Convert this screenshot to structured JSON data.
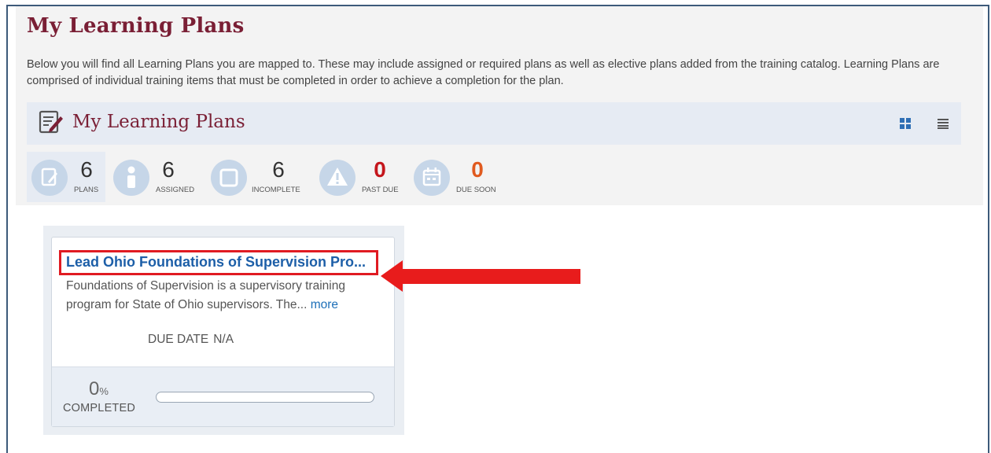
{
  "page": {
    "title": "My Learning Plans",
    "intro": "Below you will find all Learning Plans you are mapped to. These may include assigned or required plans as well as elective plans added from the training catalog. Learning Plans are comprised of individual training items that must be completed in order to achieve a completion for the plan."
  },
  "header": {
    "title": "My Learning Plans",
    "icon": "edit-document-icon",
    "grid_view_icon": "grid-view-icon",
    "list_view_icon": "list-view-icon"
  },
  "stats": [
    {
      "count": "6",
      "label": "PLANS",
      "icon": "plans-icon"
    },
    {
      "count": "6",
      "label": "ASSIGNED",
      "icon": "info-person-icon"
    },
    {
      "count": "6",
      "label": "INCOMPLETE",
      "icon": "incomplete-square-icon"
    },
    {
      "count": "0",
      "label": "PAST DUE",
      "icon": "warning-icon"
    },
    {
      "count": "0",
      "label": "DUE SOON",
      "icon": "calendar-icon"
    }
  ],
  "plan_card": {
    "title": "Lead Ohio Foundations of Supervision Pro...",
    "description": "Foundations of Supervision is a supervisory training program for State of Ohio supervisors. The...",
    "more_label": "more",
    "due_date_label": "DUE DATE",
    "due_date_value": "N/A",
    "progress_percent": "0",
    "percent_sign": "%",
    "completed_label": "COMPLETED"
  },
  "colors": {
    "brand_maroon": "#7a1f35",
    "link_blue": "#1d5fa8",
    "highlight_red": "#e01b22",
    "past_due_red": "#c4161c",
    "due_soon_orange": "#e05a1f"
  }
}
